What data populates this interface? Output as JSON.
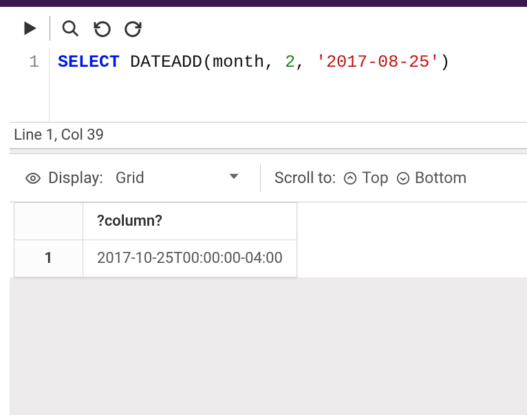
{
  "editor": {
    "line_number": "1",
    "code": {
      "keyword": "SELECT",
      "func": "DATEADD",
      "open": "(",
      "arg1": "month",
      "comma1": ",",
      "sp1": " ",
      "arg2": "2",
      "comma2": ",",
      "sp2": " ",
      "arg3": "'2017-08-25'",
      "close": ")"
    },
    "status": "Line 1, Col 39"
  },
  "results": {
    "display_label": "Display:",
    "display_value": "Grid",
    "scroll_label": "Scroll to:",
    "scroll_top": "Top",
    "scroll_bottom": "Bottom",
    "column_header": "?column?",
    "row_number": "1",
    "cell_value": "2017-10-25T00:00:00-04:00"
  }
}
